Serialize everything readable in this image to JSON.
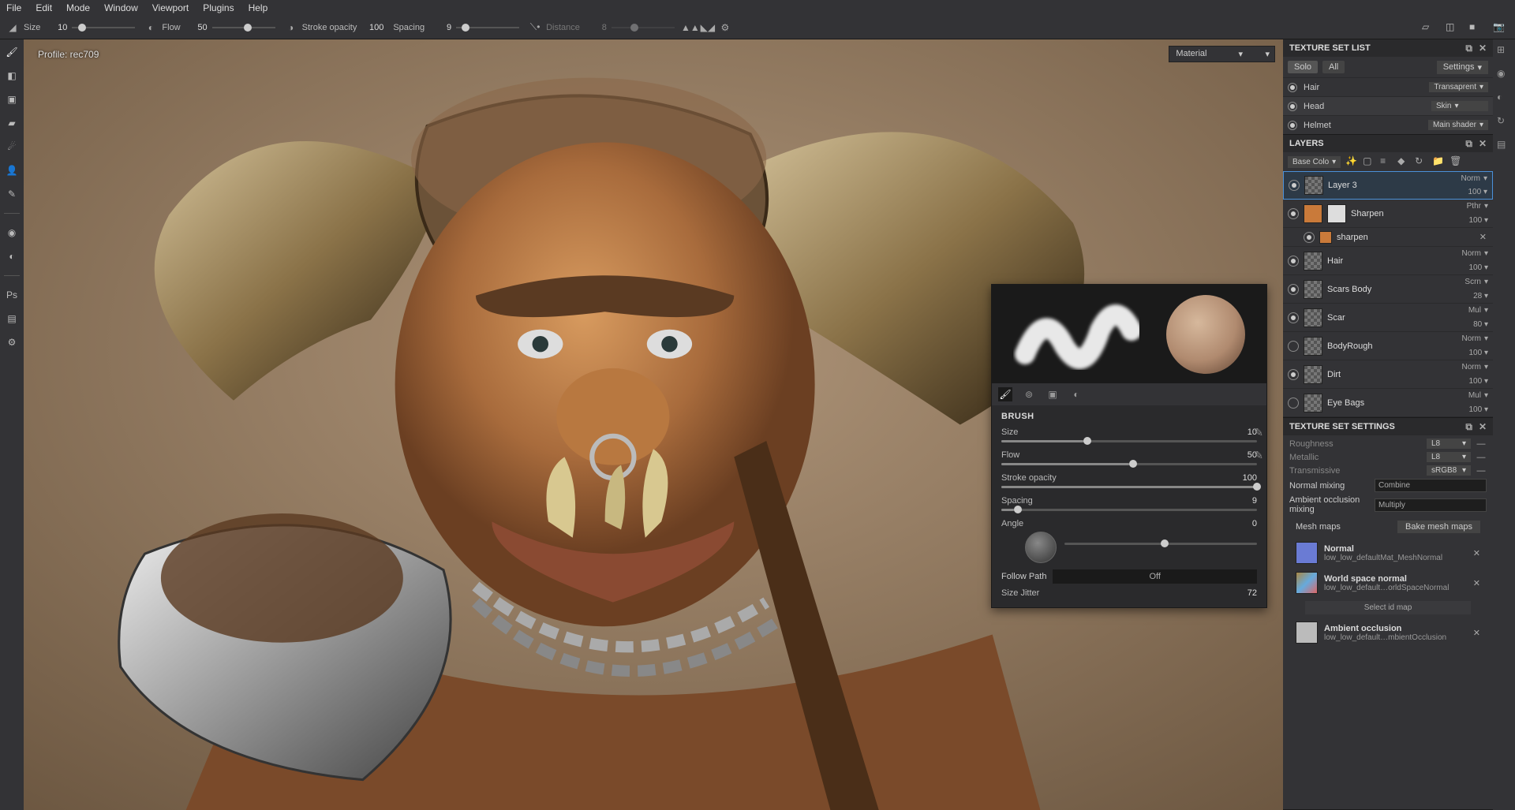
{
  "menu": {
    "items": [
      "File",
      "Edit",
      "Mode",
      "Window",
      "Viewport",
      "Plugins",
      "Help"
    ]
  },
  "toolbar": {
    "size": {
      "label": "Size",
      "value": "10",
      "pct": 10
    },
    "flow": {
      "label": "Flow",
      "value": "50",
      "pct": 50
    },
    "stroke": {
      "label": "Stroke opacity",
      "value": "100",
      "pct": 100
    },
    "spacing": {
      "label": "Spacing",
      "value": "9",
      "pct": 9
    },
    "distance": {
      "label": "Distance",
      "value": "8",
      "pct": 30
    }
  },
  "viewport": {
    "profile": "Profile: rec709",
    "material_dropdown": "Material"
  },
  "brush_panel": {
    "title": "BRUSH",
    "size": {
      "label": "Size",
      "value": "10",
      "pct": 10
    },
    "flow": {
      "label": "Flow",
      "value": "50",
      "pct": 50
    },
    "stroke": {
      "label": "Stroke opacity",
      "value": "100",
      "pct": 100
    },
    "spacing": {
      "label": "Spacing",
      "value": "9",
      "pct": 5
    },
    "angle": {
      "label": "Angle",
      "value": "0",
      "pct": 50
    },
    "follow": {
      "label": "Follow Path",
      "toggle": "Off"
    },
    "jitter": {
      "label": "Size Jitter",
      "value": "72"
    }
  },
  "texture_set_list": {
    "title": "TEXTURE SET LIST",
    "solo": "Solo",
    "all": "All",
    "settings": "Settings",
    "items": [
      {
        "name": "Hair",
        "shader": "Transaprent",
        "on": true
      },
      {
        "name": "Head",
        "shader": "Skin",
        "on": true,
        "active": true
      },
      {
        "name": "Helmet",
        "shader": "Main shader",
        "on": true
      }
    ]
  },
  "layers": {
    "title": "LAYERS",
    "channel": "Base Colo",
    "items": [
      {
        "name": "Layer 3",
        "blend": "Norm",
        "opacity": "100",
        "eye": true,
        "selected": true
      },
      {
        "name": "Sharpen",
        "blend": "Pthr",
        "opacity": "100",
        "eye": true,
        "thumbs": [
          "orange",
          "white"
        ],
        "sub": {
          "name": "sharpen"
        }
      },
      {
        "name": "Hair",
        "blend": "Norm",
        "opacity": "100",
        "eye": true
      },
      {
        "name": "Scars Body",
        "blend": "Scrn",
        "opacity": "28",
        "eye": true
      },
      {
        "name": "Scar",
        "blend": "Mul",
        "opacity": "80",
        "eye": true
      },
      {
        "name": "BodyRough",
        "blend": "Norm",
        "opacity": "100",
        "eye": false
      },
      {
        "name": "Dirt",
        "blend": "Norm",
        "opacity": "100",
        "eye": true
      },
      {
        "name": "Eye Bags",
        "blend": "Mul",
        "opacity": "100",
        "eye": false
      }
    ]
  },
  "texture_set_settings": {
    "title": "TEXTURE SET SETTINGS",
    "channels": [
      {
        "name": "Roughness",
        "fmt": "L8"
      },
      {
        "name": "Metallic",
        "fmt": "L8"
      },
      {
        "name": "Transmissive",
        "fmt": "sRGB8"
      }
    ],
    "normal_mixing": {
      "label": "Normal mixing",
      "value": "Combine"
    },
    "ao_mixing": {
      "label": "Ambient occlusion mixing",
      "value": "Multiply"
    },
    "mesh_maps": {
      "label": "Mesh maps",
      "button": "Bake mesh maps"
    },
    "maps": [
      {
        "name": "Normal",
        "file": "low_low_defaultMat_MeshNormal",
        "cls": "nm"
      },
      {
        "name": "World space normal",
        "file": "low_low_default…orldSpaceNormal",
        "cls": "wsn"
      },
      {
        "name": "Ambient occlusion",
        "file": "low_low_default…mbientOcclusion",
        "cls": "ao"
      }
    ],
    "select_id": "Select id map"
  }
}
